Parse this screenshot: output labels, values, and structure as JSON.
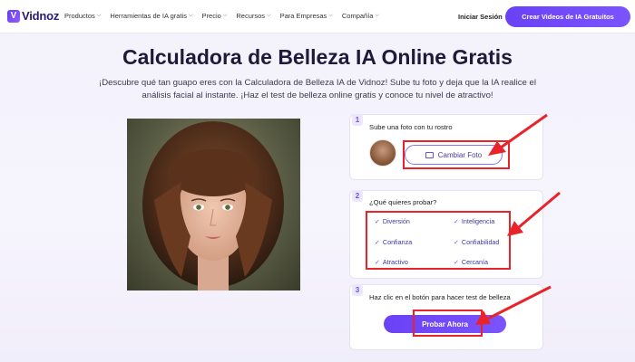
{
  "header": {
    "logo_text": "Vidnoz",
    "nav": [
      {
        "label": "Productos"
      },
      {
        "label": "Herramientas de IA gratis"
      },
      {
        "label": "Precio"
      },
      {
        "label": "Recursos"
      },
      {
        "label": "Para Empresas"
      },
      {
        "label": "Compañía"
      }
    ],
    "login_label": "Iniciar Sesión",
    "cta_label": "Crear Videos de IA Gratuitos"
  },
  "main": {
    "title": "Calculadora de Belleza IA Online Gratis",
    "subtitle": "¡Descubre qué tan guapo eres con la Calculadora de Belleza IA de Vidnoz! Sube tu foto y deja que la IA realice el análisis facial al instante. ¡Haz el test de belleza online gratis y conoce tu nivel de atractivo!"
  },
  "steps": {
    "step1": {
      "num": "1",
      "title": "Sube una foto con tu rostro",
      "button_label": "Cambiar Foto"
    },
    "step2": {
      "num": "2",
      "title": "¿Qué quieres probar?",
      "options": [
        {
          "label": "Diversión"
        },
        {
          "label": "Inteligencia"
        },
        {
          "label": "Confianza"
        },
        {
          "label": "Confiabilidad"
        },
        {
          "label": "Atractivo"
        },
        {
          "label": "Cercanía"
        }
      ]
    },
    "step3": {
      "num": "3",
      "title": "Haz clic en el botón para hacer test de belleza",
      "button_label": "Probar Ahora"
    }
  },
  "colors": {
    "accent": "#6a41f4",
    "annotation": "#e8232a"
  }
}
